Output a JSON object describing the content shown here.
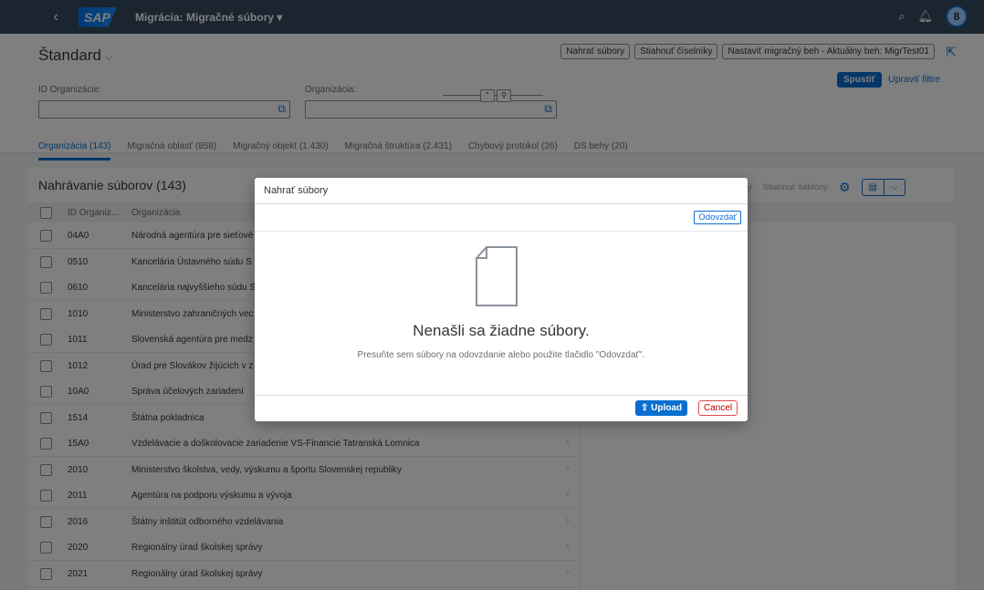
{
  "shell": {
    "back_icon": "chevron-left-icon",
    "logo": "SAP",
    "title": "Migrácia: Migračné súbory ▾",
    "icons": [
      "search-icon",
      "bell-icon"
    ],
    "avatar_initial": "8"
  },
  "header": {
    "variant": "Štandard",
    "buttons": {
      "upload_files": "Nahrať súbory",
      "download_codelists": "Stiahnuť číselníky",
      "set_run": "Nastaviť migračný beh - Aktuálny beh: MigrTest01"
    },
    "filters": {
      "org_id_label": "ID Organizácie:",
      "org_label": "Organizácia:",
      "org_id_value": "",
      "org_value": ""
    },
    "go_button": "Spustiť",
    "adapt_filters": "Upraviť filtre"
  },
  "tabs": [
    "Organizácia (143)",
    "Migračná oblasť (858)",
    "Migračný objekt (1.430)",
    "Migračná štruktúra (2.431)",
    "Chybový protokol (26)",
    "DS behy (20)"
  ],
  "table": {
    "title": "Nahrávanie súborov (143)",
    "toolbar": {
      "files_partial": "úbory",
      "download_templates": "Stiahnuť šablóny"
    },
    "columns": [
      "ID Organiz...",
      "Organizácia"
    ],
    "rows": [
      {
        "id": "04A0",
        "org": "Národná agentúra pre sieťové"
      },
      {
        "id": "0510",
        "org": "Kancelária Ústavného súdu S"
      },
      {
        "id": "0610",
        "org": "Kancelária najvyššieho súdu S"
      },
      {
        "id": "1010",
        "org": "Ministerstvo zahraničných vec"
      },
      {
        "id": "1011",
        "org": "Slovenská agentúra pre medz"
      },
      {
        "id": "1012",
        "org": "Úrad pre Slovákov žijúcich v z"
      },
      {
        "id": "10A0",
        "org": "Správa účelových zariadení"
      },
      {
        "id": "1514",
        "org": "Štátna pokladnica"
      },
      {
        "id": "15A0",
        "org": "Vzdelávacie a doškolovacie zariadenie VS-Financie Tatranská Lomnica"
      },
      {
        "id": "2010",
        "org": "Ministerstvo školstva, vedy, výskumu a športu Slovenskej republiky"
      },
      {
        "id": "2011",
        "org": "Agentúra na podporu výskumu a vývoja"
      },
      {
        "id": "2016",
        "org": "Štátny inštitút odborného vzdelávania"
      },
      {
        "id": "2020",
        "org": "Regionálny úrad školskej správy"
      },
      {
        "id": "2021",
        "org": "Regionálny úrad školskej správy"
      }
    ]
  },
  "dialog": {
    "title": "Nahrať súbory",
    "upload_button_top": "Odovzdať",
    "empty_title": "Nenašli sa žiadne súbory.",
    "empty_hint": "Presuňte sem súbory na odovzdanie alebo použite tlačidlo \"Odovzdať\".",
    "upload": "Upload",
    "cancel": "Cancel",
    "upload_icon": "upload-icon"
  }
}
